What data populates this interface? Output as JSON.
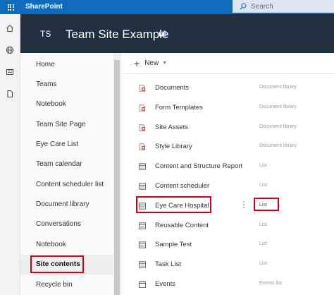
{
  "topbar": {
    "brand": "SharePoint",
    "search_placeholder": "Search"
  },
  "rail": {
    "icons": [
      "home-icon",
      "globe-icon",
      "news-icon",
      "files-icon"
    ]
  },
  "site": {
    "logo_initials": "TS",
    "title": "Team Site Example"
  },
  "leftnav": {
    "items": [
      "Home",
      "Teams",
      "Notebook",
      "Team Site Page",
      "Eye Care List",
      "Team calendar",
      "Content scheduler list",
      "Document library",
      "Conversations",
      "Notebook",
      "Site contents",
      "Recycle bin"
    ],
    "selected": "Site contents"
  },
  "commandbar": {
    "new_label": "New"
  },
  "contents": [
    {
      "name": "Documents",
      "type": "Document library",
      "icon": "library-icon"
    },
    {
      "name": "Form Templates",
      "type": "Document library",
      "icon": "library-icon"
    },
    {
      "name": "Site Assets",
      "type": "Document library",
      "icon": "library-icon"
    },
    {
      "name": "Style Library",
      "type": "Document library",
      "icon": "library-icon"
    },
    {
      "name": "Content and Structure Report",
      "type": "List",
      "icon": "list-icon"
    },
    {
      "name": "Content scheduler",
      "type": "List",
      "icon": "list-icon"
    },
    {
      "name": "Eye Care Hospital",
      "type": "List",
      "icon": "list-icon"
    },
    {
      "name": "Reusable Content",
      "type": "List",
      "icon": "list-icon"
    },
    {
      "name": "Sample Test",
      "type": "List",
      "icon": "list-icon"
    },
    {
      "name": "Task List",
      "type": "List",
      "icon": "list-icon"
    },
    {
      "name": "Events",
      "type": "Events list",
      "icon": "calendar-icon"
    }
  ],
  "row_more_label": "⋮",
  "colors": {
    "suite_bar": "#0f6cbd",
    "site_header": "#222f3e",
    "highlight": "#d0021b"
  }
}
